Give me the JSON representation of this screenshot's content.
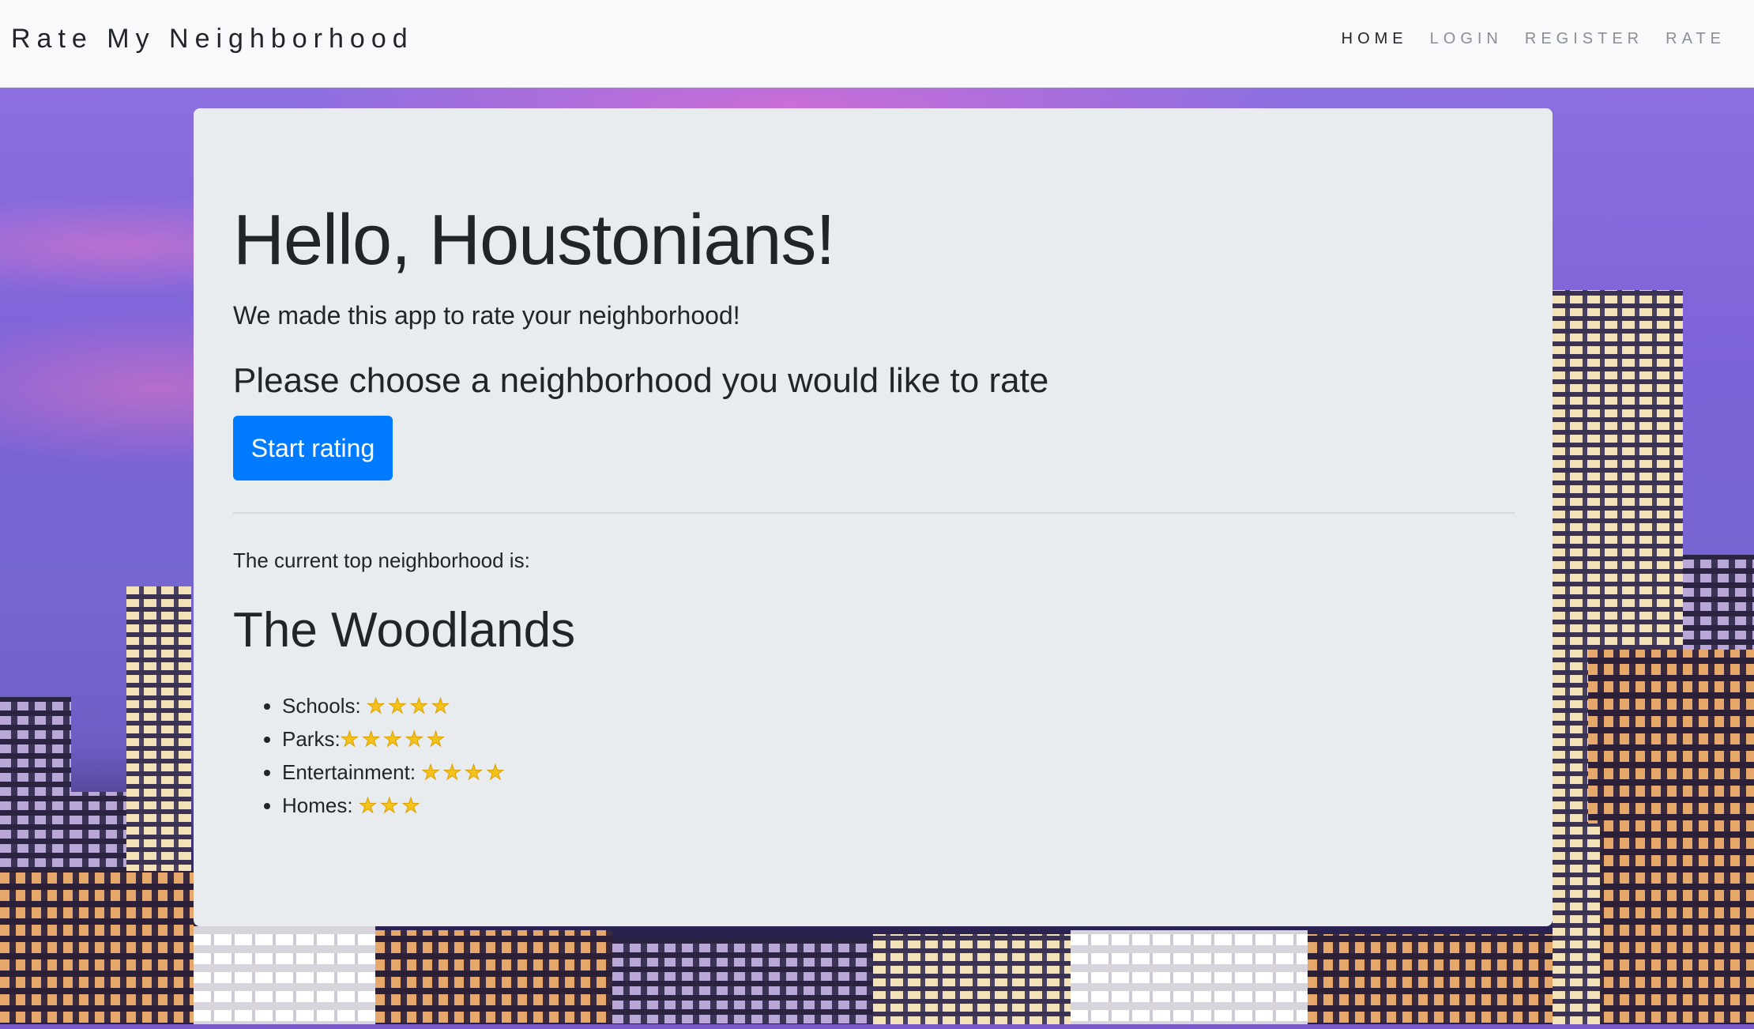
{
  "navbar": {
    "brand": "Rate My Neighborhood",
    "links": [
      "HOME",
      "LOGIN",
      "REGISTER",
      "RATE"
    ],
    "active_link": "HOME"
  },
  "jumbotron": {
    "title": "Hello, Houstonians!",
    "lead": "We made this app to rate your neighborhood!",
    "prompt": "Please choose a neighborhood you would like to rate",
    "button_label": "Start rating",
    "top_label": "The current top neighborhood is:",
    "top_neighborhood": "The Woodlands",
    "ratings": [
      {
        "label": "Schools: ",
        "stars": "★★★★",
        "count": 4
      },
      {
        "label": "Parks:",
        "stars": "★★★★★",
        "count": 5
      },
      {
        "label": "Entertainment: ",
        "stars": "★★★★",
        "count": 4
      },
      {
        "label": "Homes: ",
        "stars": "★★★",
        "count": 3
      }
    ]
  },
  "colors": {
    "navbar_bg": "#f8f9fa",
    "card_bg": "#e9ecef",
    "primary_button": "#007bff",
    "star": "#f4c21b"
  },
  "icons": {
    "rating_icon": "star-icon"
  }
}
